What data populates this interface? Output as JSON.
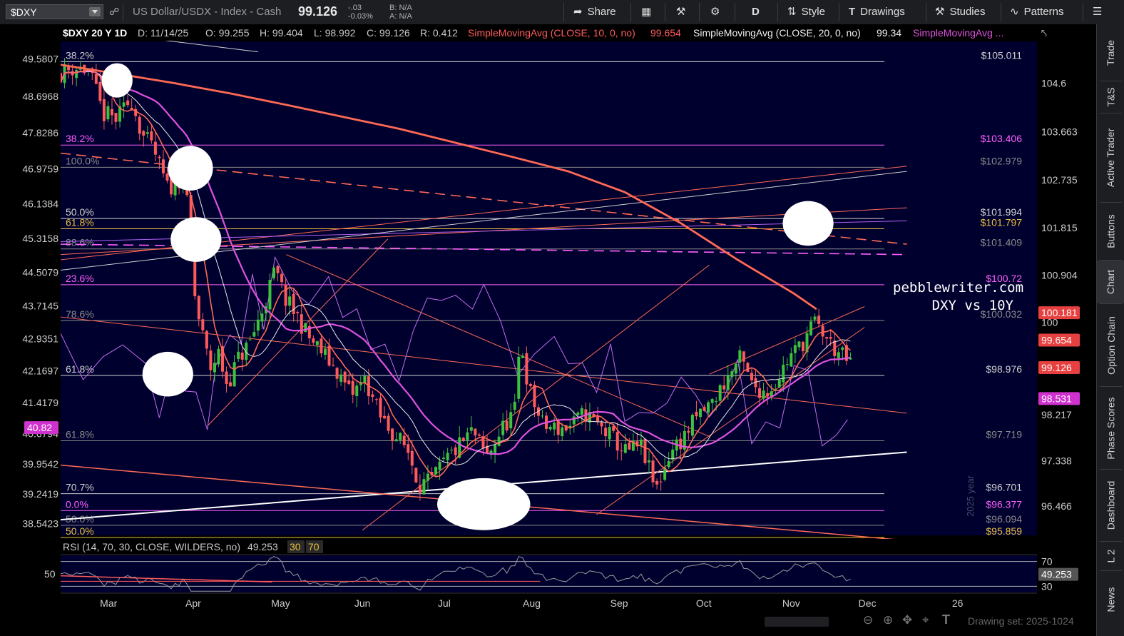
{
  "toolbar": {
    "symbol": "$DXY",
    "description": "US Dollar/USDX - Index - Cash",
    "last_price": "99.126",
    "change": "-.03",
    "change_pct": "-0.03%",
    "bid": "B: N/A",
    "ask": "A: N/A",
    "share_label": "Share",
    "period_label": "D",
    "style_label": "Style",
    "drawings_label": "Drawings",
    "studies_label": "Studies",
    "patterns_label": "Patterns"
  },
  "right_rail": {
    "tabs": [
      "Trade",
      "T&S",
      "Active Trader",
      "Buttons",
      "Chart",
      "Option Chain",
      "Phase Scores",
      "Dashboard",
      "L 2",
      "News"
    ]
  },
  "chart_header": {
    "symbol_period": "$DXY 20 Y 1D",
    "date": "D: 11/14/25",
    "open": "O: 99.255",
    "high": "H: 99.404",
    "low": "L: 98.992",
    "close": "C: 99.126",
    "range": "R: 0.412",
    "sma10_label": "SimpleMovingAvg (CLOSE, 10, 0, no)",
    "sma10_value": "99.654",
    "sma20_label": "SimpleMovingAvg (CLOSE, 20, 0, no)",
    "sma20_value": "99.34",
    "sma3_label": "SimpleMovingAvg ..."
  },
  "rsi_header": {
    "label": "RSI (14, 70, 30, CLOSE, WILDERS, no)",
    "value": "49.253",
    "low": "30",
    "high": "70"
  },
  "watermark": {
    "line1": "pebblewriter.com",
    "line2": "DXY vs 10Y",
    "year": "2025 year",
    "drawing_set": "Drawing set: 2025-1024"
  },
  "colors": {
    "background": "#00002e",
    "candle_up": "#3cc23c",
    "candle_down": "#ff5a5a",
    "sma10": "#ff6a55",
    "sma20": "#e8e8e8",
    "sma50": "#e052e0",
    "sma200": "#ff6a55",
    "tnx": "#c56cf0",
    "fib_white": "#d0d0d0",
    "fib_magenta": "#ff5fff",
    "fib_yellow": "#e8c040"
  },
  "chart_data": {
    "type": "line",
    "title": "$DXY 20 Y 1D",
    "ylim": [
      95.9,
      105.4
    ],
    "left_axis_lim": [
      38.26,
      50.0
    ],
    "x_labels": [
      "Mar",
      "Apr",
      "May",
      "Jun",
      "Jul",
      "Aug",
      "Sep",
      "Oct",
      "Nov",
      "Dec",
      "26"
    ],
    "right_axis_ticks": [
      104.6,
      103.663,
      102.735,
      101.815,
      100.904,
      100,
      98.217,
      97.338,
      96.466
    ],
    "left_axis_ticks": [
      49.5807,
      48.6968,
      47.8286,
      46.9759,
      46.1384,
      45.3158,
      44.5079,
      43.7145,
      42.9351,
      42.1697,
      41.4179,
      40.6794,
      39.9542,
      39.2419,
      38.5423
    ],
    "price_tags": [
      {
        "value": "100.181",
        "color": "#e74040"
      },
      {
        "value": "99.654",
        "color": "#e74040"
      },
      {
        "value": "99.126",
        "color": "#e74040"
      },
      {
        "value": "98.531",
        "color": "#d032d0"
      }
    ],
    "left_tag": {
      "value": "40.82",
      "color": "#d032d0"
    },
    "fib_levels": [
      {
        "y": 105.011,
        "pct": "38.2%",
        "price": "$105.011",
        "color": "#d0d0d0"
      },
      {
        "y": 103.406,
        "pct": "38.2%",
        "price": "$103.406",
        "color": "#ff5fff"
      },
      {
        "y": 102.979,
        "pct": "100.0%",
        "price": "$102.979",
        "color": "#8a8a8a"
      },
      {
        "y": 101.994,
        "pct": "50.0%",
        "price": "$101.994",
        "color": "#d0d0d0"
      },
      {
        "y": 101.797,
        "pct": "61.8%",
        "price": "$101.797",
        "color": "#e8c040"
      },
      {
        "y": 101.409,
        "pct": "88.6%",
        "price": "$101.409",
        "color": "#8a8a8a"
      },
      {
        "y": 100.72,
        "pct": "23.6%",
        "price": "$100.72",
        "color": "#ff5fff"
      },
      {
        "y": 100.032,
        "pct": "78.6%",
        "price": "$100.032",
        "color": "#8a8a8a"
      },
      {
        "y": 98.976,
        "pct": "61.8%",
        "price": "$98.976",
        "color": "#d0d0d0"
      },
      {
        "y": 97.719,
        "pct": "61.8%",
        "price": "$97.719",
        "color": "#8a8a8a"
      },
      {
        "y": 96.701,
        "pct": "70.7%",
        "price": "$96.701",
        "color": "#d0d0d0"
      },
      {
        "y": 96.377,
        "pct": "0.0%",
        "price": "$96.377",
        "color": "#ff5fff"
      },
      {
        "y": 96.094,
        "pct": "50.0%",
        "price": "$96.094",
        "color": "#8a8a8a"
      },
      {
        "y": 95.859,
        "pct": "50.0%",
        "price": "$95.859",
        "color": "#e8c040"
      }
    ],
    "ellipses": [
      {
        "d": 20,
        "y": 104.65,
        "rd": 5.5,
        "ry": 0.33
      },
      {
        "d": 46,
        "y": 102.96,
        "rd": 8,
        "ry": 0.43
      },
      {
        "d": 48,
        "y": 101.59,
        "rd": 9,
        "ry": 0.43
      },
      {
        "d": 38,
        "y": 99.0,
        "rd": 9,
        "ry": 0.43
      },
      {
        "d": 150,
        "y": 96.5,
        "rd": 16.5,
        "ry": 0.5
      },
      {
        "d": 265,
        "y": 101.9,
        "rd": 9,
        "ry": 0.43
      }
    ],
    "trendlines": [
      {
        "d1": 0,
        "y1": 103.25,
        "d2": 300,
        "y2": 101.5,
        "color": "#ff6a55",
        "dash": true,
        "w": 1.6
      },
      {
        "d1": 0,
        "y1": 101.5,
        "d2": 300,
        "y2": 101.3,
        "color": "#ff5fff",
        "dash": true,
        "w": 1.6
      },
      {
        "d1": 0,
        "y1": 101.3,
        "d2": 300,
        "y2": 102.2,
        "color": "#ff6a55",
        "dash": false,
        "w": 1
      },
      {
        "d1": 0,
        "y1": 101.2,
        "d2": 300,
        "y2": 103.0,
        "color": "#ff6a55",
        "dash": false,
        "w": 1
      },
      {
        "d1": 0,
        "y1": 101.55,
        "d2": 300,
        "y2": 101.95,
        "color": "#b060f0",
        "dash": false,
        "w": 1
      },
      {
        "d1": 0,
        "y1": 101.0,
        "d2": 300,
        "y2": 102.9,
        "color": "#d0d0d0",
        "dash": false,
        "w": 1
      },
      {
        "d1": 0,
        "y1": 96.2,
        "d2": 300,
        "y2": 97.5,
        "color": "#ffffff",
        "dash": false,
        "w": 2
      },
      {
        "d1": 0,
        "y1": 97.25,
        "d2": 300,
        "y2": 95.8,
        "color": "#ff6a55",
        "dash": false,
        "w": 1.5
      },
      {
        "d1": 0,
        "y1": 100.1,
        "d2": 300,
        "y2": 98.25,
        "color": "#ff6a55",
        "dash": false,
        "w": 1
      },
      {
        "d1": 52,
        "y1": 98.0,
        "d2": 116,
        "y2": 101.6,
        "color": "#ff6a55",
        "dash": false,
        "w": 1
      },
      {
        "d1": 107,
        "y1": 96.0,
        "d2": 230,
        "y2": 101.1,
        "color": "#ff6a55",
        "dash": false,
        "w": 1
      },
      {
        "d1": 190,
        "y1": 96.3,
        "d2": 285,
        "y2": 99.9,
        "color": "#ff6a55",
        "dash": false,
        "w": 1
      },
      {
        "d1": 230,
        "y1": 99.0,
        "d2": 285,
        "y2": 100.3,
        "color": "#ff6a55",
        "dash": false,
        "w": 1
      },
      {
        "d1": 80,
        "y1": 101.3,
        "d2": 230,
        "y2": 97.8,
        "color": "#ff6a55",
        "dash": false,
        "w": 1
      },
      {
        "d1": 10,
        "y1": 105.6,
        "d2": 70,
        "y2": 105.2,
        "color": "#d0d0d0",
        "dash": false,
        "w": 1
      }
    ],
    "rsi_lim": [
      20,
      80
    ],
    "rsi_levels": [
      70,
      30
    ],
    "sma200": [
      {
        "d": 0,
        "y": 104.95
      },
      {
        "d": 20,
        "y": 104.78
      },
      {
        "d": 40,
        "y": 104.6
      },
      {
        "d": 60,
        "y": 104.4
      },
      {
        "d": 80,
        "y": 104.18
      },
      {
        "d": 100,
        "y": 103.95
      },
      {
        "d": 120,
        "y": 103.72
      },
      {
        "d": 140,
        "y": 103.45
      },
      {
        "d": 160,
        "y": 103.18
      },
      {
        "d": 180,
        "y": 102.9
      },
      {
        "d": 200,
        "y": 102.5
      },
      {
        "d": 220,
        "y": 101.9
      },
      {
        "d": 240,
        "y": 101.2
      },
      {
        "d": 260,
        "y": 100.55
      },
      {
        "d": 268,
        "y": 100.25
      }
    ]
  }
}
